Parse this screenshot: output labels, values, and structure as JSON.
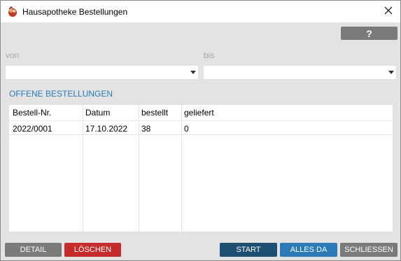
{
  "window": {
    "title": "Hausapotheke Bestellungen",
    "app_icon": "app-logo-icon",
    "close_icon": "close-icon"
  },
  "toolbar": {
    "help_label": "?"
  },
  "filters": {
    "from_label": "von",
    "from_value": "",
    "to_label": "bis",
    "to_value": ""
  },
  "orders": {
    "section_title": "OFFENE BESTELLUNGEN",
    "columns": [
      "Bestell-Nr.",
      "Datum",
      "bestellt",
      "geliefert"
    ],
    "rows": [
      [
        "2022/0001",
        "17.10.2022",
        "38",
        "0"
      ]
    ]
  },
  "buttons": {
    "detail": "DETAIL",
    "delete": "LÖSCHEN",
    "start": "START",
    "all_here": "ALLES DA",
    "close": "SCHLIESSEN"
  },
  "colors": {
    "gray_button": "#7a7a7a",
    "red_button": "#c42b2b",
    "dark_blue_button": "#1e4f72",
    "blue_button": "#2b7bb8",
    "section_title": "#2a7ab8"
  }
}
